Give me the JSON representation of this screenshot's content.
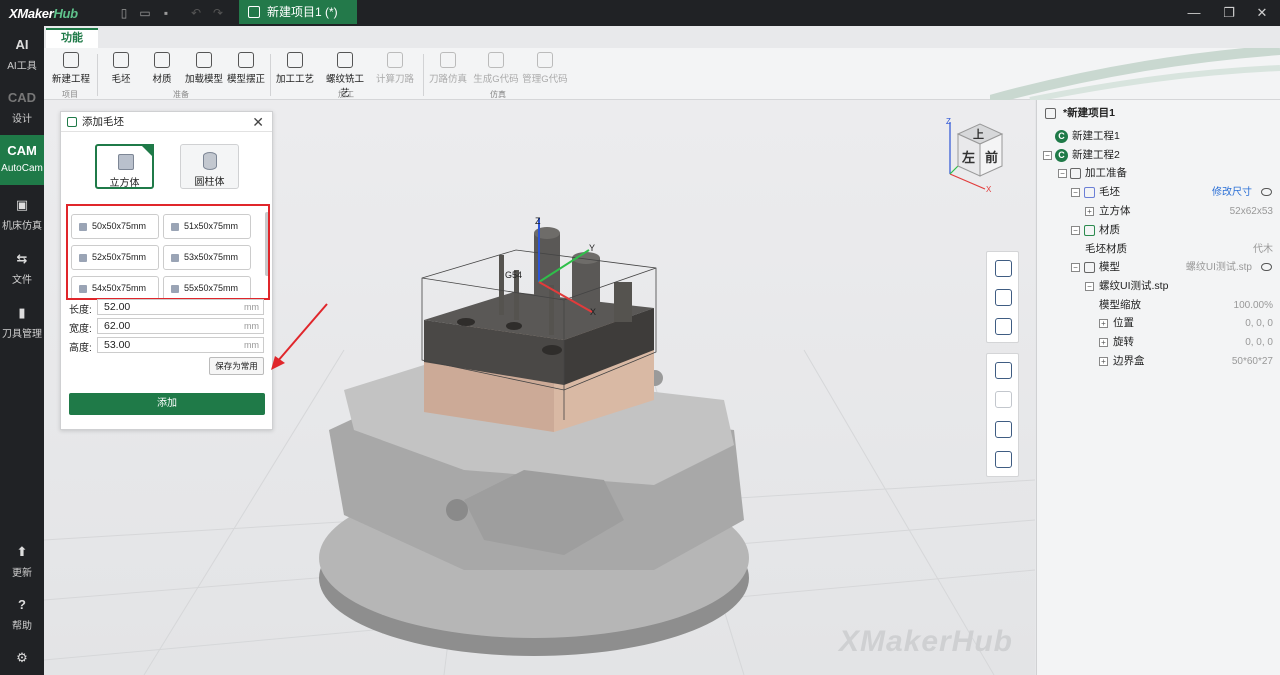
{
  "app": {
    "brand_prefix": "XMaker",
    "brand_suffix": "Hub",
    "project_tab": "新建项目1 (*)"
  },
  "window": {
    "min": "—",
    "restore": "❐",
    "close": "✕"
  },
  "left_nav": [
    {
      "glyph": "AI",
      "label": "AI工具"
    },
    {
      "glyph": "CAD",
      "label": "设计"
    },
    {
      "glyph": "CAM",
      "label": "AutoCam"
    },
    {
      "glyph": "▣",
      "label": "机床仿真"
    },
    {
      "glyph": "⇆",
      "label": "文件"
    },
    {
      "glyph": "▮",
      "label": "刀具管理"
    },
    {
      "glyph": "⬆",
      "label": "更新"
    },
    {
      "glyph": "?",
      "label": "帮助"
    },
    {
      "glyph": "⚙",
      "label": ""
    }
  ],
  "ribbon": {
    "tab": "功能",
    "buttons": [
      "新建工程",
      "毛坯",
      "材质",
      "加载模型",
      "模型摆正",
      "加工工艺",
      "螺纹铣工艺",
      "计算刀路",
      "刀路仿真",
      "生成G代码",
      "管理G代码"
    ],
    "groups": [
      "项目",
      "准备",
      "加工",
      "仿真"
    ]
  },
  "dialog": {
    "title": "添加毛坯",
    "shapes": [
      "立方体",
      "圆柱体"
    ],
    "presets": [
      "50x50x75mm",
      "51x50x75mm",
      "52x50x75mm",
      "53x50x75mm",
      "54x50x75mm",
      "55x50x75mm"
    ],
    "fields": [
      {
        "label": "长度:",
        "value": "52.00",
        "unit": "mm"
      },
      {
        "label": "宽度:",
        "value": "62.00",
        "unit": "mm"
      },
      {
        "label": "高度:",
        "value": "53.00",
        "unit": "mm"
      }
    ],
    "save_label": "保存为常用",
    "add_label": "添加"
  },
  "viewport": {
    "watermark": "XMakerHub",
    "cube_faces": {
      "top": "上",
      "left": "左",
      "front": "前"
    },
    "axes": {
      "x": "X",
      "y": "Y",
      "z": "Z"
    },
    "g54": "G54"
  },
  "tree": {
    "root": "*新建项目1",
    "items": [
      {
        "label": "新建工程1",
        "value": "",
        "link": ""
      },
      {
        "label": "新建工程2",
        "value": "",
        "link": ""
      },
      {
        "label": "加工准备",
        "value": "",
        "link": ""
      },
      {
        "label": "毛坯",
        "value": "",
        "link": "修改尺寸"
      },
      {
        "label": "立方体",
        "value": "52x62x53",
        "link": ""
      },
      {
        "label": "材质",
        "value": "",
        "link": ""
      },
      {
        "label": "毛坯材质",
        "value": "代木",
        "link": ""
      },
      {
        "label": "模型",
        "value": "螺纹UI测试.stp",
        "link": ""
      },
      {
        "label": "螺纹UI测试.stp",
        "value": "",
        "link": ""
      },
      {
        "label": "模型缩放",
        "value": "100.00%",
        "link": ""
      },
      {
        "label": "位置",
        "value": "0, 0, 0",
        "link": ""
      },
      {
        "label": "旋转",
        "value": "0, 0, 0",
        "link": ""
      },
      {
        "label": "边界盒",
        "value": "50*60*27",
        "link": ""
      }
    ]
  },
  "colors": {
    "accent": "#1f7a48",
    "highlight": "#e0262b",
    "link": "#2a6fd6"
  }
}
